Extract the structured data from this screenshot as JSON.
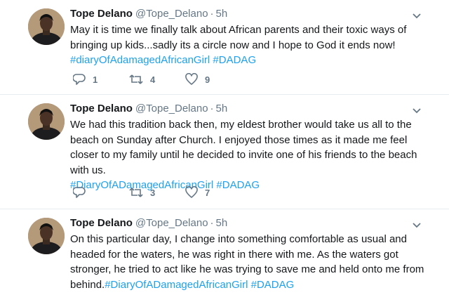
{
  "tweets": [
    {
      "author_name": "Tope Delano",
      "handle": "@Tope_Delano",
      "separator": "·",
      "time": "5h",
      "text": "May it is time we finally talk about African parents and their toxic ways of bringing up kids...sadly its a circle now and I hope to God it ends now!",
      "hashtags": "#diaryOfAdamagedAfricanGirl #DADAG",
      "replies": "1",
      "retweets": "4",
      "likes": "9"
    },
    {
      "author_name": "Tope Delano",
      "handle": "@Tope_Delano",
      "separator": "·",
      "time": "5h",
      "text": "We had this tradition back then, my eldest brother would take us all to the beach on Sunday after Church. I enjoyed those times as it made me feel closer to my family until he decided to invite one of his friends to the beach with us.",
      "hashtags": "#DiaryOfADamagedAfricanGirl #DADAG",
      "replies": "",
      "retweets": "3",
      "likes": "7"
    },
    {
      "author_name": "Tope Delano",
      "handle": "@Tope_Delano",
      "separator": "·",
      "time": "5h",
      "text": "On this particular day, I change into something comfortable as usual and headed for the waters, he was right in there with me. As the waters got stronger, he tried to act like he was trying to save me and held onto me from behind.",
      "hashtags": "#DiaryOfADamagedAfricanGirl #DADAG"
    }
  ],
  "icons": {
    "reply": "reply-icon",
    "retweet": "retweet-icon",
    "like": "heart-icon",
    "caret": "chevron-down-icon",
    "accent_color": "#1da1f2",
    "muted_color": "#657786"
  }
}
